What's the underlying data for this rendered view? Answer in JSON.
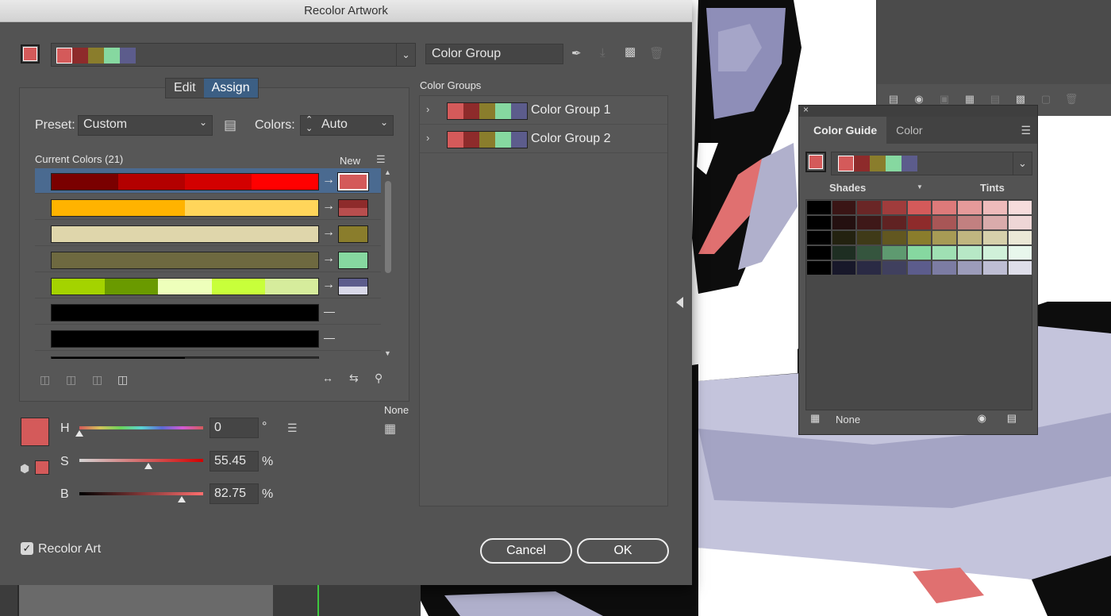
{
  "dialog": {
    "title": "Recolor Artwork",
    "group_name": "Color Group",
    "active_colors": [
      "#d45a5a",
      "#8e2b2b",
      "#8a7d2c",
      "#86d8a0",
      "#5c5c8c"
    ],
    "tabs": {
      "edit": "Edit",
      "assign": "Assign"
    },
    "preset_label": "Preset:",
    "preset_value": "Custom",
    "colors_label": "Colors:",
    "colors_value": "Auto",
    "current_colors_label": "Current Colors (21)",
    "new_label": "New",
    "rows": [
      {
        "colors": [
          "#7a0000",
          "#b30000",
          "#d30000",
          "#ff0000"
        ],
        "new": {
          "top": "#d45a5a",
          "bottom": "#d45a5a",
          "split": true
        },
        "selected": true
      },
      {
        "colors": [
          "#ffb300",
          "#ffd55a"
        ],
        "new": {
          "top": "#8e2b2b",
          "bottom": "#b84e4e",
          "split": true
        },
        "selected": false
      },
      {
        "colors": [
          "#dfd6ab"
        ],
        "new": {
          "top": "#8a7d2c",
          "bottom": "#8a7d2c",
          "split": true
        },
        "selected": false
      },
      {
        "colors": [
          "#6e6940"
        ],
        "new": {
          "top": "#86d8a0",
          "bottom": "#86d8a0",
          "split": true
        },
        "selected": false
      },
      {
        "colors": [
          "#a4d300",
          "#6a9a00",
          "#eeffbb",
          "#c8ff3a",
          "#d6ec9c"
        ],
        "new": {
          "top": "#5c5c8c",
          "bottom": "#d8d8e8",
          "split": true
        },
        "selected": false
      },
      {
        "colors": [
          "#000000"
        ],
        "new": null,
        "selected": false
      },
      {
        "colors": [
          "#000000"
        ],
        "new": null,
        "selected": false
      },
      {
        "colors": [
          "#000000",
          "#2a2a2a"
        ],
        "new": null,
        "selected": false
      }
    ],
    "hsb": {
      "h_label": "H",
      "h_value": "0",
      "h_unit": "°",
      "s_label": "S",
      "s_value": "55.45",
      "s_unit": "%",
      "b_label": "B",
      "b_value": "82.75",
      "b_unit": "%",
      "h_fraction": 0.0,
      "s_fraction": 0.5545,
      "b_fraction": 0.8275
    },
    "none_label": "None",
    "color_groups_label": "Color Groups",
    "groups": [
      {
        "name": "Color Group 1",
        "colors": [
          "#d45a5a",
          "#8e2b2b",
          "#8a7d2c",
          "#86d8a0",
          "#5c5c8c"
        ]
      },
      {
        "name": "Color Group 2",
        "colors": [
          "#d45a5a",
          "#8e2b2b",
          "#8a7d2c",
          "#86d8a0",
          "#5c5c8c"
        ]
      }
    ],
    "recolor_art_label": "Recolor Art",
    "recolor_art_checked": true,
    "cancel_label": "Cancel",
    "ok_label": "OK"
  },
  "guide": {
    "tabs": [
      "Color Guide",
      "Color"
    ],
    "active_tab": "Color Guide",
    "colors": [
      "#d45a5a",
      "#8e2b2b",
      "#8a7d2c",
      "#86d8a0",
      "#5c5c8c"
    ],
    "shades_label": "Shades",
    "tints_label": "Tints",
    "footer_none": "None",
    "grid": [
      [
        "#000000",
        "#3a1515",
        "#6a2626",
        "#a03c3c",
        "#d45a5a",
        "#dd7a7a",
        "#e59a9a",
        "#eebbbb",
        "#f6dcdc"
      ],
      [
        "#000000",
        "#241010",
        "#3e1818",
        "#602222",
        "#8e2b2b",
        "#a85656",
        "#c28080",
        "#d9abab",
        "#eed6d6"
      ],
      [
        "#000000",
        "#232210",
        "#3f3a18",
        "#625720",
        "#8a7d2c",
        "#a79b55",
        "#c0b680",
        "#d6d0ab",
        "#ebe8d6"
      ],
      [
        "#000000",
        "#1e2e22",
        "#35553e",
        "#5e9a70",
        "#86d8a0",
        "#9fe0b3",
        "#b7e8c6",
        "#d0f0d9",
        "#e8f7ec"
      ],
      [
        "#000000",
        "#18182a",
        "#2a2a44",
        "#40405e",
        "#5c5c8c",
        "#7c7ca3",
        "#9c9cba",
        "#bebed3",
        "#dedee9"
      ]
    ]
  }
}
